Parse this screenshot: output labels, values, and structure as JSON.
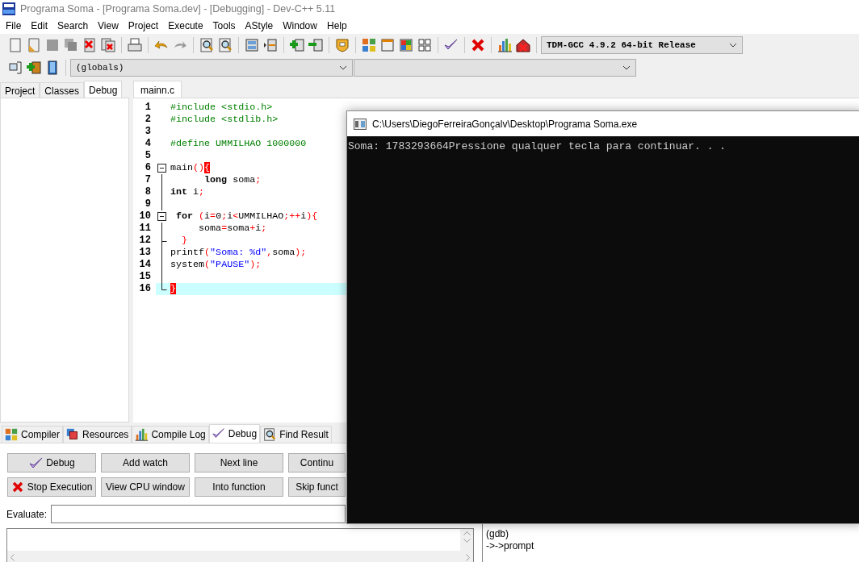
{
  "window": {
    "title": "Programa Soma - [Programa Soma.dev] - [Debugging] - Dev-C++ 5.11"
  },
  "menu": [
    "File",
    "Edit",
    "Search",
    "View",
    "Project",
    "Execute",
    "Tools",
    "AStyle",
    "Window",
    "Help"
  ],
  "toolbar": {
    "compiler": "TDM-GCC 4.9.2 64-bit Release",
    "scope": "(globals)"
  },
  "left_tabs": [
    {
      "label": "Project",
      "selected": false
    },
    {
      "label": "Classes",
      "selected": false
    },
    {
      "label": "Debug",
      "selected": true
    }
  ],
  "editor": {
    "tabs": [
      {
        "label": "mainn.c",
        "selected": true
      }
    ],
    "lines": [
      {
        "number": "1",
        "kind": "plain",
        "current": false,
        "tokens": [
          {
            "kind": "preproc",
            "text": "#include <stdio.h>"
          }
        ]
      },
      {
        "number": "2",
        "kind": "plain",
        "current": false,
        "tokens": [
          {
            "kind": "preproc",
            "text": "#include <stdlib.h>"
          }
        ]
      },
      {
        "number": "3",
        "kind": "plain",
        "current": false
      },
      {
        "number": "4",
        "kind": "plain",
        "current": false,
        "tokens": [
          {
            "kind": "preproc",
            "text": "#define UMMILHAO 1000000"
          }
        ]
      },
      {
        "number": "5",
        "kind": "plain",
        "current": false
      },
      {
        "number": "6",
        "kind": "fold_start",
        "current": false,
        "tokens": [
          {
            "kind": "plain",
            "text": "main"
          },
          {
            "kind": "symbol",
            "text": "()"
          },
          {
            "kind": "match",
            "text": "{"
          }
        ]
      },
      {
        "number": "7",
        "kind": "fold_body",
        "current": false,
        "tokens": [
          {
            "kind": "keyword",
            "text": "      long"
          },
          {
            "kind": "plain",
            "text": " soma"
          },
          {
            "kind": "symbol",
            "text": ";"
          }
        ]
      },
      {
        "number": "8",
        "kind": "fold_body",
        "current": false,
        "tokens": [
          {
            "kind": "keyword",
            "text": "int"
          },
          {
            "kind": "plain",
            "text": " i"
          },
          {
            "kind": "symbol",
            "text": ";"
          }
        ]
      },
      {
        "number": "9",
        "kind": "fold_body",
        "current": false
      },
      {
        "number": "10",
        "kind": "fold_start",
        "current": false,
        "tokens": [
          {
            "kind": "keyword",
            "text": " for "
          },
          {
            "kind": "symbol",
            "text": "("
          },
          {
            "kind": "plain",
            "text": "i"
          },
          {
            "kind": "symbol",
            "text": "="
          },
          {
            "kind": "plain",
            "text": "0"
          },
          {
            "kind": "symbol",
            "text": ";"
          },
          {
            "kind": "plain",
            "text": "i"
          },
          {
            "kind": "symbol",
            "text": "<"
          },
          {
            "kind": "plain",
            "text": "UMMILHAO"
          },
          {
            "kind": "symbol",
            "text": ";++"
          },
          {
            "kind": "plain",
            "text": "i"
          },
          {
            "kind": "symbol",
            "text": "){"
          }
        ]
      },
      {
        "number": "11",
        "kind": "fold_body",
        "current": false,
        "tokens": [
          {
            "kind": "plain",
            "text": "     soma"
          },
          {
            "kind": "symbol",
            "text": "="
          },
          {
            "kind": "plain",
            "text": "soma"
          },
          {
            "kind": "symbol",
            "text": "+"
          },
          {
            "kind": "plain",
            "text": "i"
          },
          {
            "kind": "symbol",
            "text": ";"
          }
        ]
      },
      {
        "number": "12",
        "kind": "fold_branch_end",
        "current": false,
        "tokens": [
          {
            "kind": "symbol",
            "text": "  }"
          }
        ]
      },
      {
        "number": "13",
        "kind": "fold_body",
        "current": false,
        "tokens": [
          {
            "kind": "plain",
            "text": "printf"
          },
          {
            "kind": "symbol",
            "text": "("
          },
          {
            "kind": "string",
            "text": "\"Soma: %d\""
          },
          {
            "kind": "symbol",
            "text": ","
          },
          {
            "kind": "plain",
            "text": "soma"
          },
          {
            "kind": "symbol",
            "text": ");"
          }
        ]
      },
      {
        "number": "14",
        "kind": "fold_body",
        "current": false,
        "tokens": [
          {
            "kind": "plain",
            "text": "system"
          },
          {
            "kind": "symbol",
            "text": "("
          },
          {
            "kind": "string",
            "text": "\"PAUSE\""
          },
          {
            "kind": "symbol",
            "text": ");"
          }
        ]
      },
      {
        "number": "15",
        "kind": "fold_body",
        "current": false
      },
      {
        "number": "16",
        "kind": "fold_end",
        "current": true,
        "tokens": [
          {
            "kind": "match",
            "text": "}"
          }
        ]
      }
    ]
  },
  "bottom_tabs": [
    {
      "label": "Compiler",
      "selected": false
    },
    {
      "label": "Resources",
      "selected": false
    },
    {
      "label": "Compile Log",
      "selected": false
    },
    {
      "label": "Debug",
      "selected": true
    },
    {
      "label": "Find Result",
      "selected": false
    }
  ],
  "debug": {
    "buttons": [
      {
        "label": "Debug"
      },
      {
        "label": "Add watch"
      },
      {
        "label": "Next line"
      },
      {
        "label": "Continu"
      },
      {
        "label": "Stop Execution"
      },
      {
        "label": "View CPU window"
      },
      {
        "label": "Into function"
      },
      {
        "label": "Skip funct"
      }
    ],
    "evaluate_label": "Evaluate:",
    "gdb_output": [
      "(gdb)",
      "->->prompt"
    ]
  },
  "console": {
    "title": "C:\\Users\\DiegoFerreiraGonçalv\\Desktop\\Programa Soma.exe",
    "output": "Soma: 1783293664Pressione qualquer tecla para continuar. . ."
  }
}
